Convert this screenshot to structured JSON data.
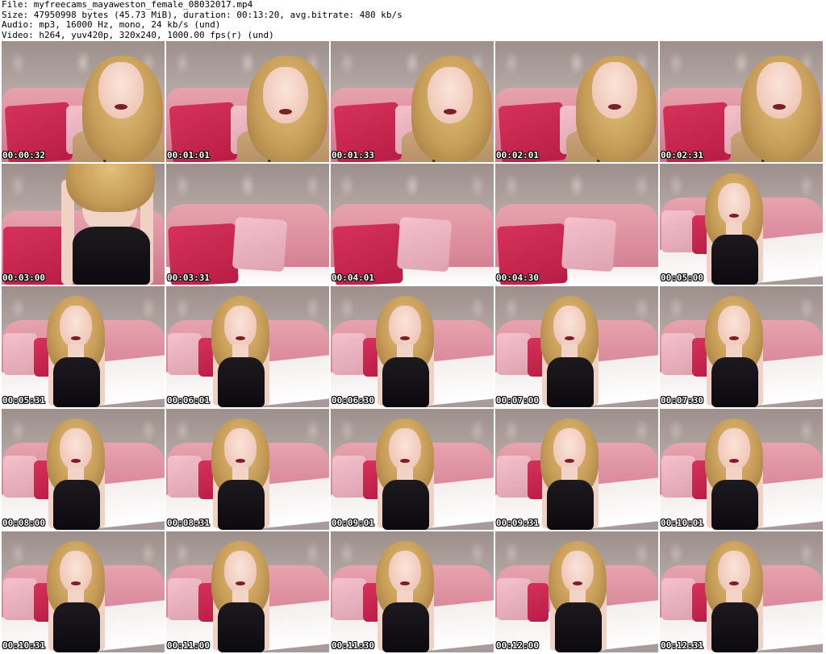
{
  "header": {
    "file": "File: myfreecams_mayaweston_female_08032017.mp4",
    "size": "Size: 47950998 bytes (45.73 MiB), duration: 00:13:20, avg.bitrate: 480 kb/s",
    "audio": "Audio: mp3, 16000 Hz, mono, 24 kb/s (und)",
    "video": "Video: h264, yuv420p, 320x240, 1000.00 fps(r) (und)"
  },
  "thumbnails": [
    {
      "timestamp": "00:00:32",
      "scene": "closeup"
    },
    {
      "timestamp": "00:01:01",
      "scene": "closeup-down"
    },
    {
      "timestamp": "00:01:33",
      "scene": "closeup-down"
    },
    {
      "timestamp": "00:02:01",
      "scene": "closeup"
    },
    {
      "timestamp": "00:02:31",
      "scene": "closeup"
    },
    {
      "timestamp": "00:03:00",
      "scene": "torso"
    },
    {
      "timestamp": "00:03:31",
      "scene": "empty"
    },
    {
      "timestamp": "00:04:01",
      "scene": "empty"
    },
    {
      "timestamp": "00:04:30",
      "scene": "empty"
    },
    {
      "timestamp": "00:05:00",
      "scene": "seated"
    },
    {
      "timestamp": "00:05:31",
      "scene": "seated"
    },
    {
      "timestamp": "00:06:01",
      "scene": "seated"
    },
    {
      "timestamp": "00:06:30",
      "scene": "seated"
    },
    {
      "timestamp": "00:07:00",
      "scene": "seated"
    },
    {
      "timestamp": "00:07:30",
      "scene": "seated"
    },
    {
      "timestamp": "00:08:00",
      "scene": "seated"
    },
    {
      "timestamp": "00:08:31",
      "scene": "seated"
    },
    {
      "timestamp": "00:09:01",
      "scene": "seated"
    },
    {
      "timestamp": "00:09:31",
      "scene": "seated"
    },
    {
      "timestamp": "00:10:01",
      "scene": "seated"
    },
    {
      "timestamp": "00:10:31",
      "scene": "seated"
    },
    {
      "timestamp": "00:11:00",
      "scene": "seated"
    },
    {
      "timestamp": "00:11:30",
      "scene": "seated"
    },
    {
      "timestamp": "00:12:00",
      "scene": "leaning"
    },
    {
      "timestamp": "00:12:31",
      "scene": "seated"
    }
  ],
  "colors": {
    "background": "#ffffff",
    "header_text": "#000000",
    "timestamp_text": "#ffffff",
    "timestamp_outline": "#000000"
  }
}
